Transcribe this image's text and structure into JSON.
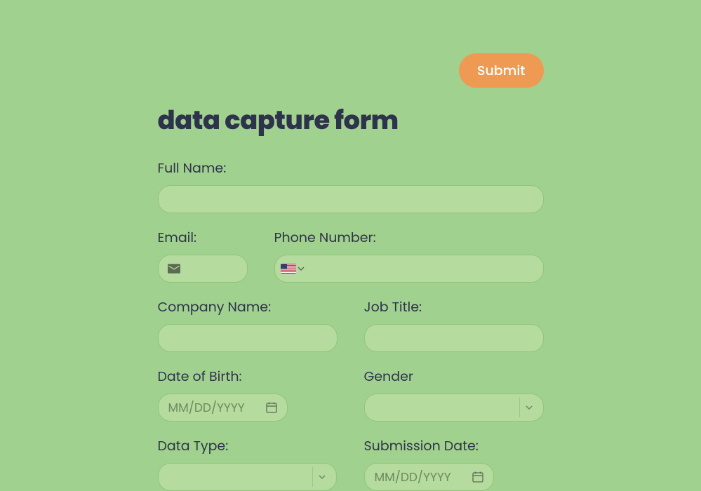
{
  "submit_label": "Submit",
  "title": "data capture form",
  "fields": {
    "full_name": {
      "label": "Full Name:"
    },
    "email": {
      "label": "Email:"
    },
    "phone": {
      "label": "Phone Number:",
      "country": "US"
    },
    "company": {
      "label": "Company Name:"
    },
    "job_title": {
      "label": "Job Title:"
    },
    "dob": {
      "label": "Date of Birth:",
      "placeholder": "MM/DD/YYYY"
    },
    "gender": {
      "label": "Gender"
    },
    "data_type": {
      "label": "Data Type:"
    },
    "submission_date": {
      "label": "Submission Date:",
      "placeholder": "MM/DD/YYYY"
    }
  },
  "colors": {
    "background": "#a1d18e",
    "input_bg": "#b5db9f",
    "input_border": "#90c57a",
    "submit_bg": "#ef9a53",
    "text": "#2e334c",
    "placeholder": "#6b8a5c"
  }
}
